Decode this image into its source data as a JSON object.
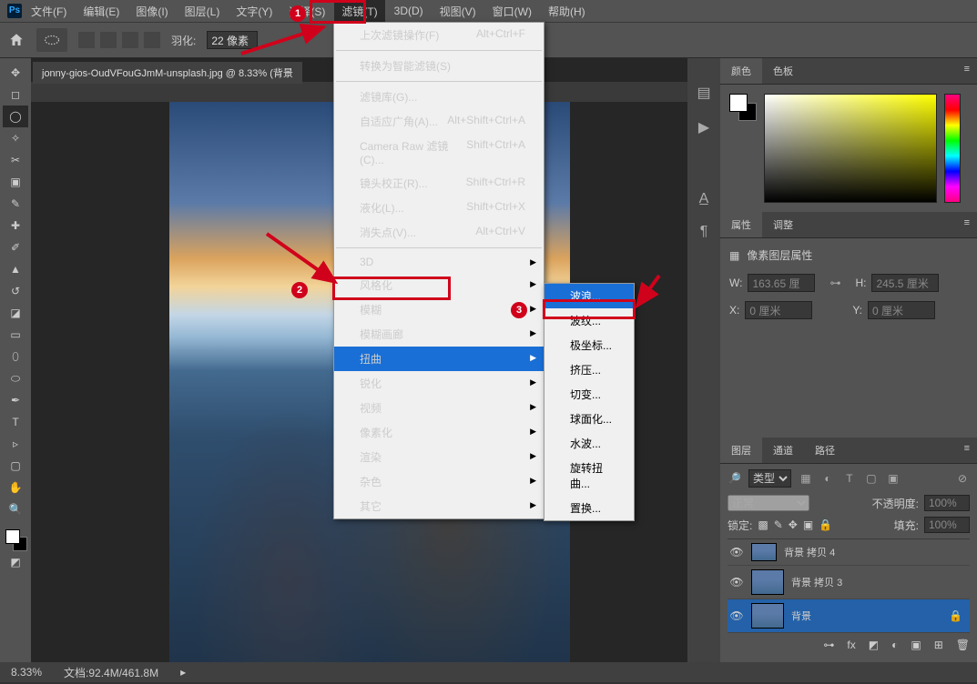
{
  "menubar": {
    "items": [
      "文件(F)",
      "编辑(E)",
      "图像(I)",
      "图层(L)",
      "文字(Y)",
      "选择(S)",
      "滤镜(T)",
      "3D(D)",
      "视图(V)",
      "窗口(W)",
      "帮助(H)"
    ]
  },
  "optbar": {
    "feather_label": "羽化:",
    "feather_value": "22 像素"
  },
  "doc_tab": "jonny-gios-OudVFouGJmM-unsplash.jpg @ 8.33% (背景",
  "filter_menu": [
    {
      "label": "上次滤镜操作(F)",
      "shortcut": "Alt+Ctrl+F",
      "disabled": true
    },
    {
      "sep": true
    },
    {
      "label": "转换为智能滤镜(S)"
    },
    {
      "sep": true
    },
    {
      "label": "滤镜库(G)..."
    },
    {
      "label": "自适应广角(A)...",
      "shortcut": "Alt+Shift+Ctrl+A"
    },
    {
      "label": "Camera Raw 滤镜(C)...",
      "shortcut": "Shift+Ctrl+A"
    },
    {
      "label": "镜头校正(R)...",
      "shortcut": "Shift+Ctrl+R"
    },
    {
      "label": "液化(L)...",
      "shortcut": "Shift+Ctrl+X"
    },
    {
      "label": "消失点(V)...",
      "shortcut": "Alt+Ctrl+V"
    },
    {
      "sep": true
    },
    {
      "label": "3D",
      "sub": true,
      "disabled": true
    },
    {
      "label": "风格化",
      "sub": true
    },
    {
      "label": "模糊",
      "sub": true
    },
    {
      "label": "模糊画廊",
      "sub": true
    },
    {
      "label": "扭曲",
      "sub": true,
      "hl": true
    },
    {
      "label": "锐化",
      "sub": true
    },
    {
      "label": "视频",
      "sub": true
    },
    {
      "label": "像素化",
      "sub": true
    },
    {
      "label": "渲染",
      "sub": true
    },
    {
      "label": "杂色",
      "sub": true
    },
    {
      "label": "其它",
      "sub": true
    }
  ],
  "distort_submenu": [
    "波浪...",
    "波纹...",
    "极坐标...",
    "挤压...",
    "切变...",
    "球面化...",
    "水波...",
    "旋转扭曲...",
    "置换..."
  ],
  "panels": {
    "color": {
      "tabs": [
        "颜色",
        "色板"
      ]
    },
    "props": {
      "tabs": [
        "属性",
        "调整"
      ],
      "title": "像素图层属性",
      "W_label": "W:",
      "W": "163.65 厘",
      "H_label": "H:",
      "H": "245.5 厘米",
      "X_label": "X:",
      "X": "0 厘米",
      "Y_label": "Y:",
      "Y": "0 厘米"
    },
    "layers": {
      "tabs": [
        "图层",
        "通道",
        "路径"
      ],
      "kind_label": "类型",
      "blend": "正常",
      "opacity_label": "不透明度:",
      "opacity": "100%",
      "lock_label": "锁定:",
      "fill_label": "填充:",
      "fill": "100%",
      "rows": [
        {
          "name": "背景 拷贝 4",
          "sel": false,
          "small": true
        },
        {
          "name": "背景 拷贝 3",
          "sel": false
        },
        {
          "name": "背景",
          "sel": true
        }
      ]
    }
  },
  "status": {
    "zoom": "8.33%",
    "doc": "文档:92.4M/461.8M"
  }
}
